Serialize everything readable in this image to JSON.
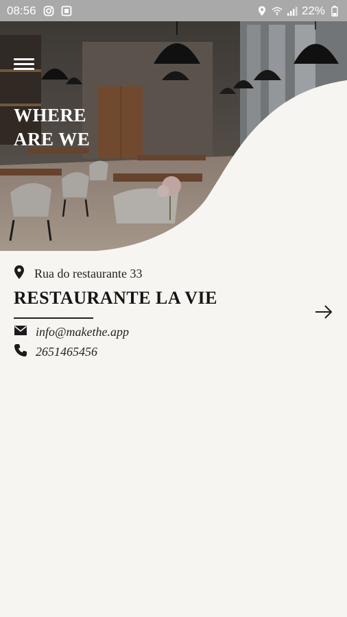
{
  "status_bar": {
    "time": "08:56",
    "battery": "22%",
    "icons": [
      "instagram-icon",
      "app-notification-icon",
      "location-icon",
      "wifi-icon",
      "signal-icon",
      "battery-icon"
    ]
  },
  "hero": {
    "title": "WHERE ARE WE",
    "image": "restaurant-interior-photo"
  },
  "location": {
    "address": "Rua do restaurante 33",
    "name": "RESTAURANTE LA VIE",
    "email": "info@makethe.app",
    "phone": "2651465456"
  },
  "colors": {
    "background": "#f7f5f1",
    "statusbar": "#a9a9a9",
    "text": "#1c1c1c"
  }
}
